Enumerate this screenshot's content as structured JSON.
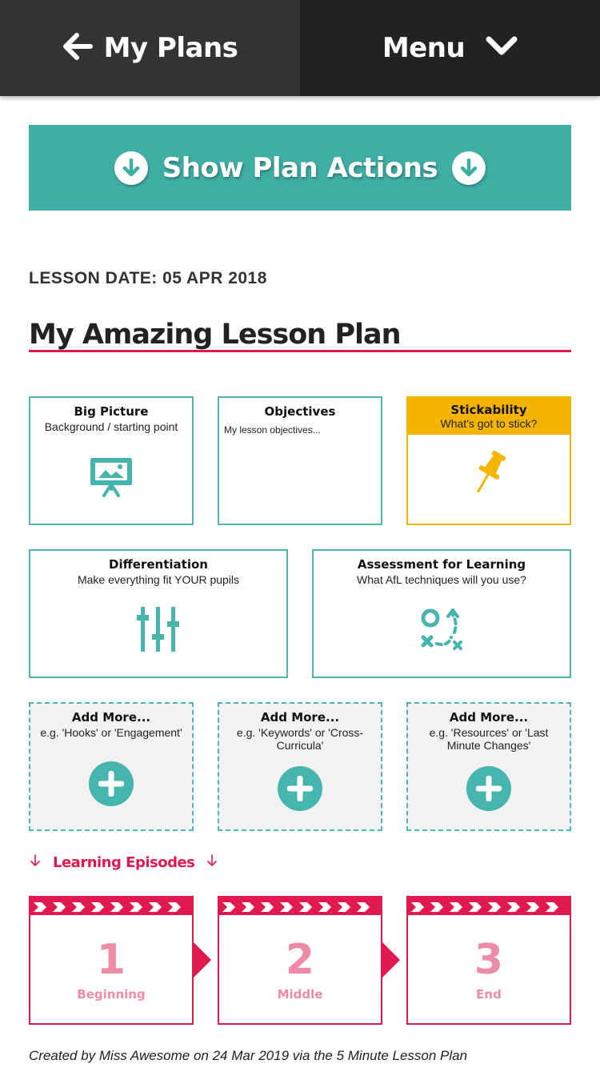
{
  "nav": {
    "back_label": "My Plans",
    "menu_label": "Menu"
  },
  "actions": {
    "label": "Show Plan Actions"
  },
  "lesson": {
    "date_label": "LESSON DATE: 05  APR 2018",
    "title": "My Amazing Lesson Plan"
  },
  "cards": {
    "big_picture": {
      "title": "Big Picture",
      "subtitle": "Background / starting point",
      "icon": "presentation-board-icon"
    },
    "objectives": {
      "title": "Objectives",
      "subtitle": "My lesson objectives..."
    },
    "stickability": {
      "title": "Stickability",
      "subtitle": "What's got to stick?",
      "icon": "pushpin-icon"
    },
    "differentiation": {
      "title": "Differentiation",
      "subtitle": "Make everything fit YOUR pupils",
      "icon": "sliders-icon"
    },
    "afl": {
      "title": "Assessment for Learning",
      "subtitle": "What AfL techniques will you use?",
      "icon": "tactics-icon"
    },
    "add_more": [
      {
        "title": "Add More...",
        "subtitle": "e.g. 'Hooks' or 'Engagement'"
      },
      {
        "title": "Add More...",
        "subtitle": "e.g. 'Keywords' or 'Cross-Curricula'"
      },
      {
        "title": "Add More...",
        "subtitle": "e.g. 'Resources' or 'Last Minute Changes'"
      }
    ]
  },
  "episodes": {
    "heading": "Learning Episodes",
    "items": [
      {
        "number": "1",
        "label": "Beginning"
      },
      {
        "number": "2",
        "label": "Middle"
      },
      {
        "number": "3",
        "label": "End"
      }
    ]
  },
  "footer": {
    "text": "Created by Miss Awesome on 24 Mar 2019 via the 5 Minute Lesson Plan"
  },
  "colors": {
    "teal": "#3fafa6",
    "pink": "#e0194f",
    "amber": "#f5b400",
    "nav_dark": "#222222"
  }
}
